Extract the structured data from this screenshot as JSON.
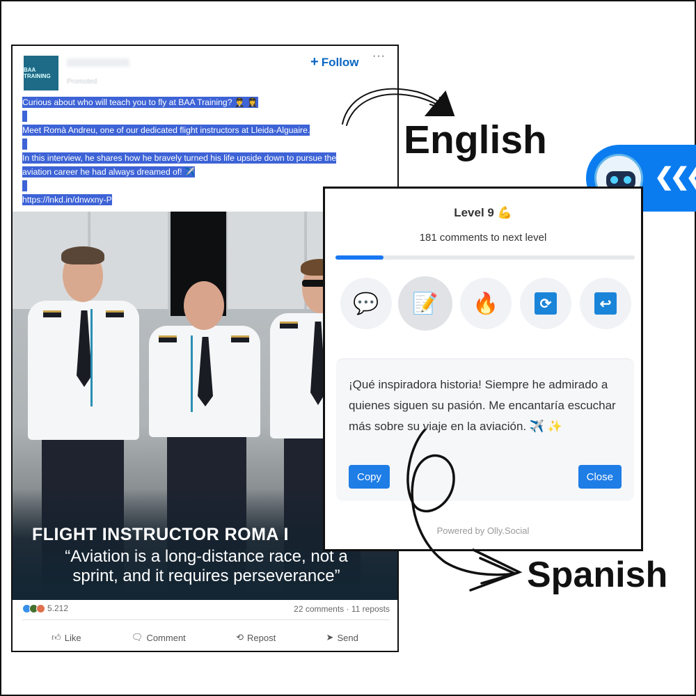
{
  "post": {
    "author_badge": "BAA TRAINING",
    "author_sub": "Promoted",
    "follow_label": "Follow",
    "more_label": "···",
    "text_lines": [
      "Curious about who will teach you to fly at BAA Training? 👨‍✈️ 👩‍✈️",
      "Meet Romà Andreu, one of our dedicated flight instructors at Lleida-Alguaire.",
      "In this interview, he shares how he bravely turned his life upside down to pursue the",
      "aviation career he had always dreamed of! ✈️",
      "https://lnkd.in/dnwxny-P"
    ],
    "photo_title": "FLIGHT INSTRUCTOR ROMA I",
    "photo_quote_1": "“Aviation is a long-distance race, not a",
    "photo_quote_2": "sprint, and it requires perseverance”",
    "reaction_count": "5.212",
    "comments_reposts": "22 comments · 11 reposts",
    "actions": {
      "like": "Like",
      "comment": "Comment",
      "repost": "Repost",
      "send": "Send"
    }
  },
  "labels": {
    "english": "English",
    "spanish": "Spanish"
  },
  "panel": {
    "level": "Level 9 💪",
    "progress_text": "181 comments to next level",
    "progress_fraction": 0.16,
    "tones": [
      {
        "name": "comment-tone-icon",
        "glyph": "💬"
      },
      {
        "name": "write-tone-icon",
        "glyph": "📝"
      },
      {
        "name": "fire-tone-icon",
        "glyph": "🔥"
      },
      {
        "name": "refresh-icon",
        "glyph": "⟳"
      },
      {
        "name": "return-icon",
        "glyph": "↩"
      }
    ],
    "reply": "¡Qué inspiradora historia! Siempre he admirado a quienes siguen su pasión. Me encantaría escuchar más sobre su viaje en la aviación. ✈️ ✨",
    "copy_label": "Copy",
    "close_label": "Close",
    "powered": "Powered by Olly.Social"
  },
  "colors": {
    "accent": "#1877f2",
    "launcher": "#0b7cf0",
    "highlight": "#3d63d6",
    "linkedin_blue": "#0a66c2"
  }
}
